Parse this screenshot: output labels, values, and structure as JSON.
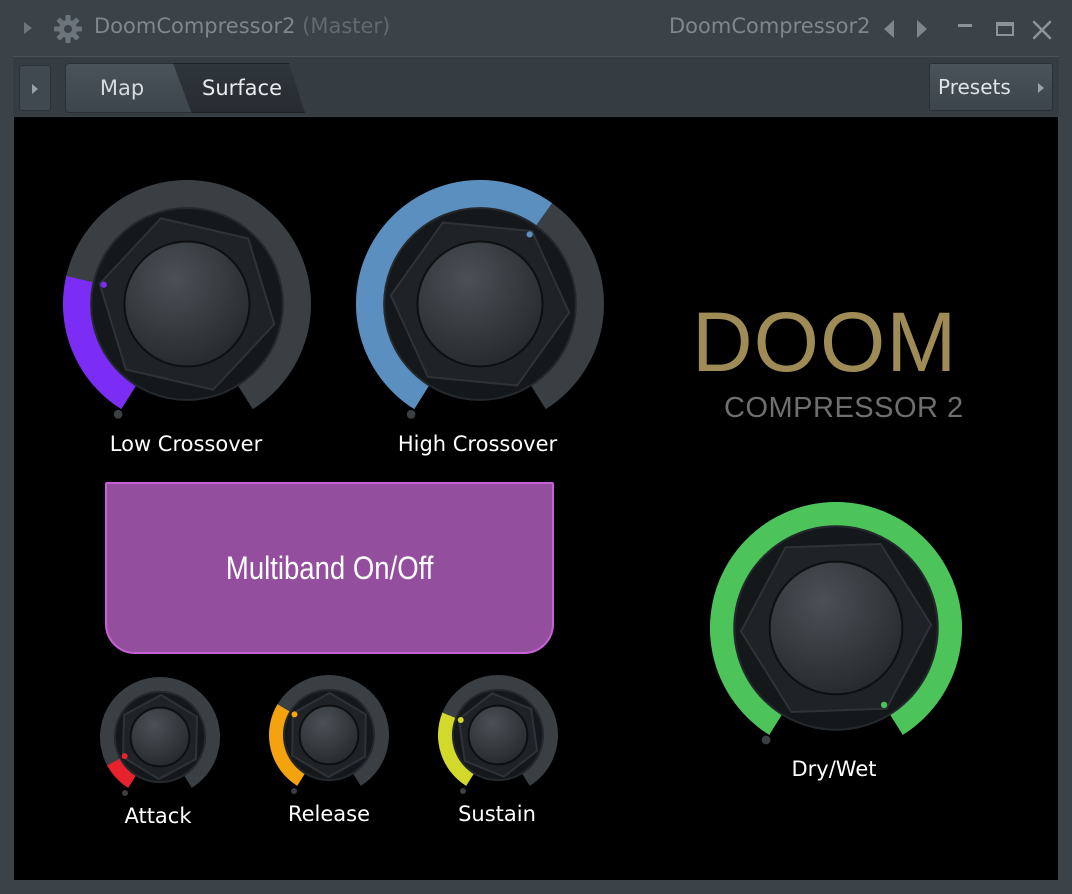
{
  "window": {
    "title": "DoomCompressor2",
    "title_suffix": "(Master)",
    "right_title": "DoomCompressor2"
  },
  "toolbar": {
    "tabs": [
      {
        "label": "Map",
        "active": false
      },
      {
        "label": "Surface",
        "active": true
      }
    ],
    "presets_label": "Presets"
  },
  "brand": {
    "title": "DOOM",
    "subtitle": "COMPRESSOR 2",
    "title_color": "#9e8b55"
  },
  "controls": {
    "low_crossover": {
      "label": "Low Crossover",
      "color": "#7b2cf5",
      "value": 0.24
    },
    "high_crossover": {
      "label": "High Crossover",
      "color": "#5a8fc0",
      "value": 0.62
    },
    "multiband": {
      "label": "Multiband On/Off",
      "color": "#934f9e"
    },
    "attack": {
      "label": "Attack",
      "color": "#e8222c",
      "value": 0.1
    },
    "release": {
      "label": "Release",
      "color": "#f5a20f",
      "value": 0.3
    },
    "sustain": {
      "label": "Sustain",
      "color": "#d3d92a",
      "value": 0.27
    },
    "dry_wet": {
      "label": "Dry/Wet",
      "color": "#4cc45a",
      "value": 1.0
    }
  }
}
